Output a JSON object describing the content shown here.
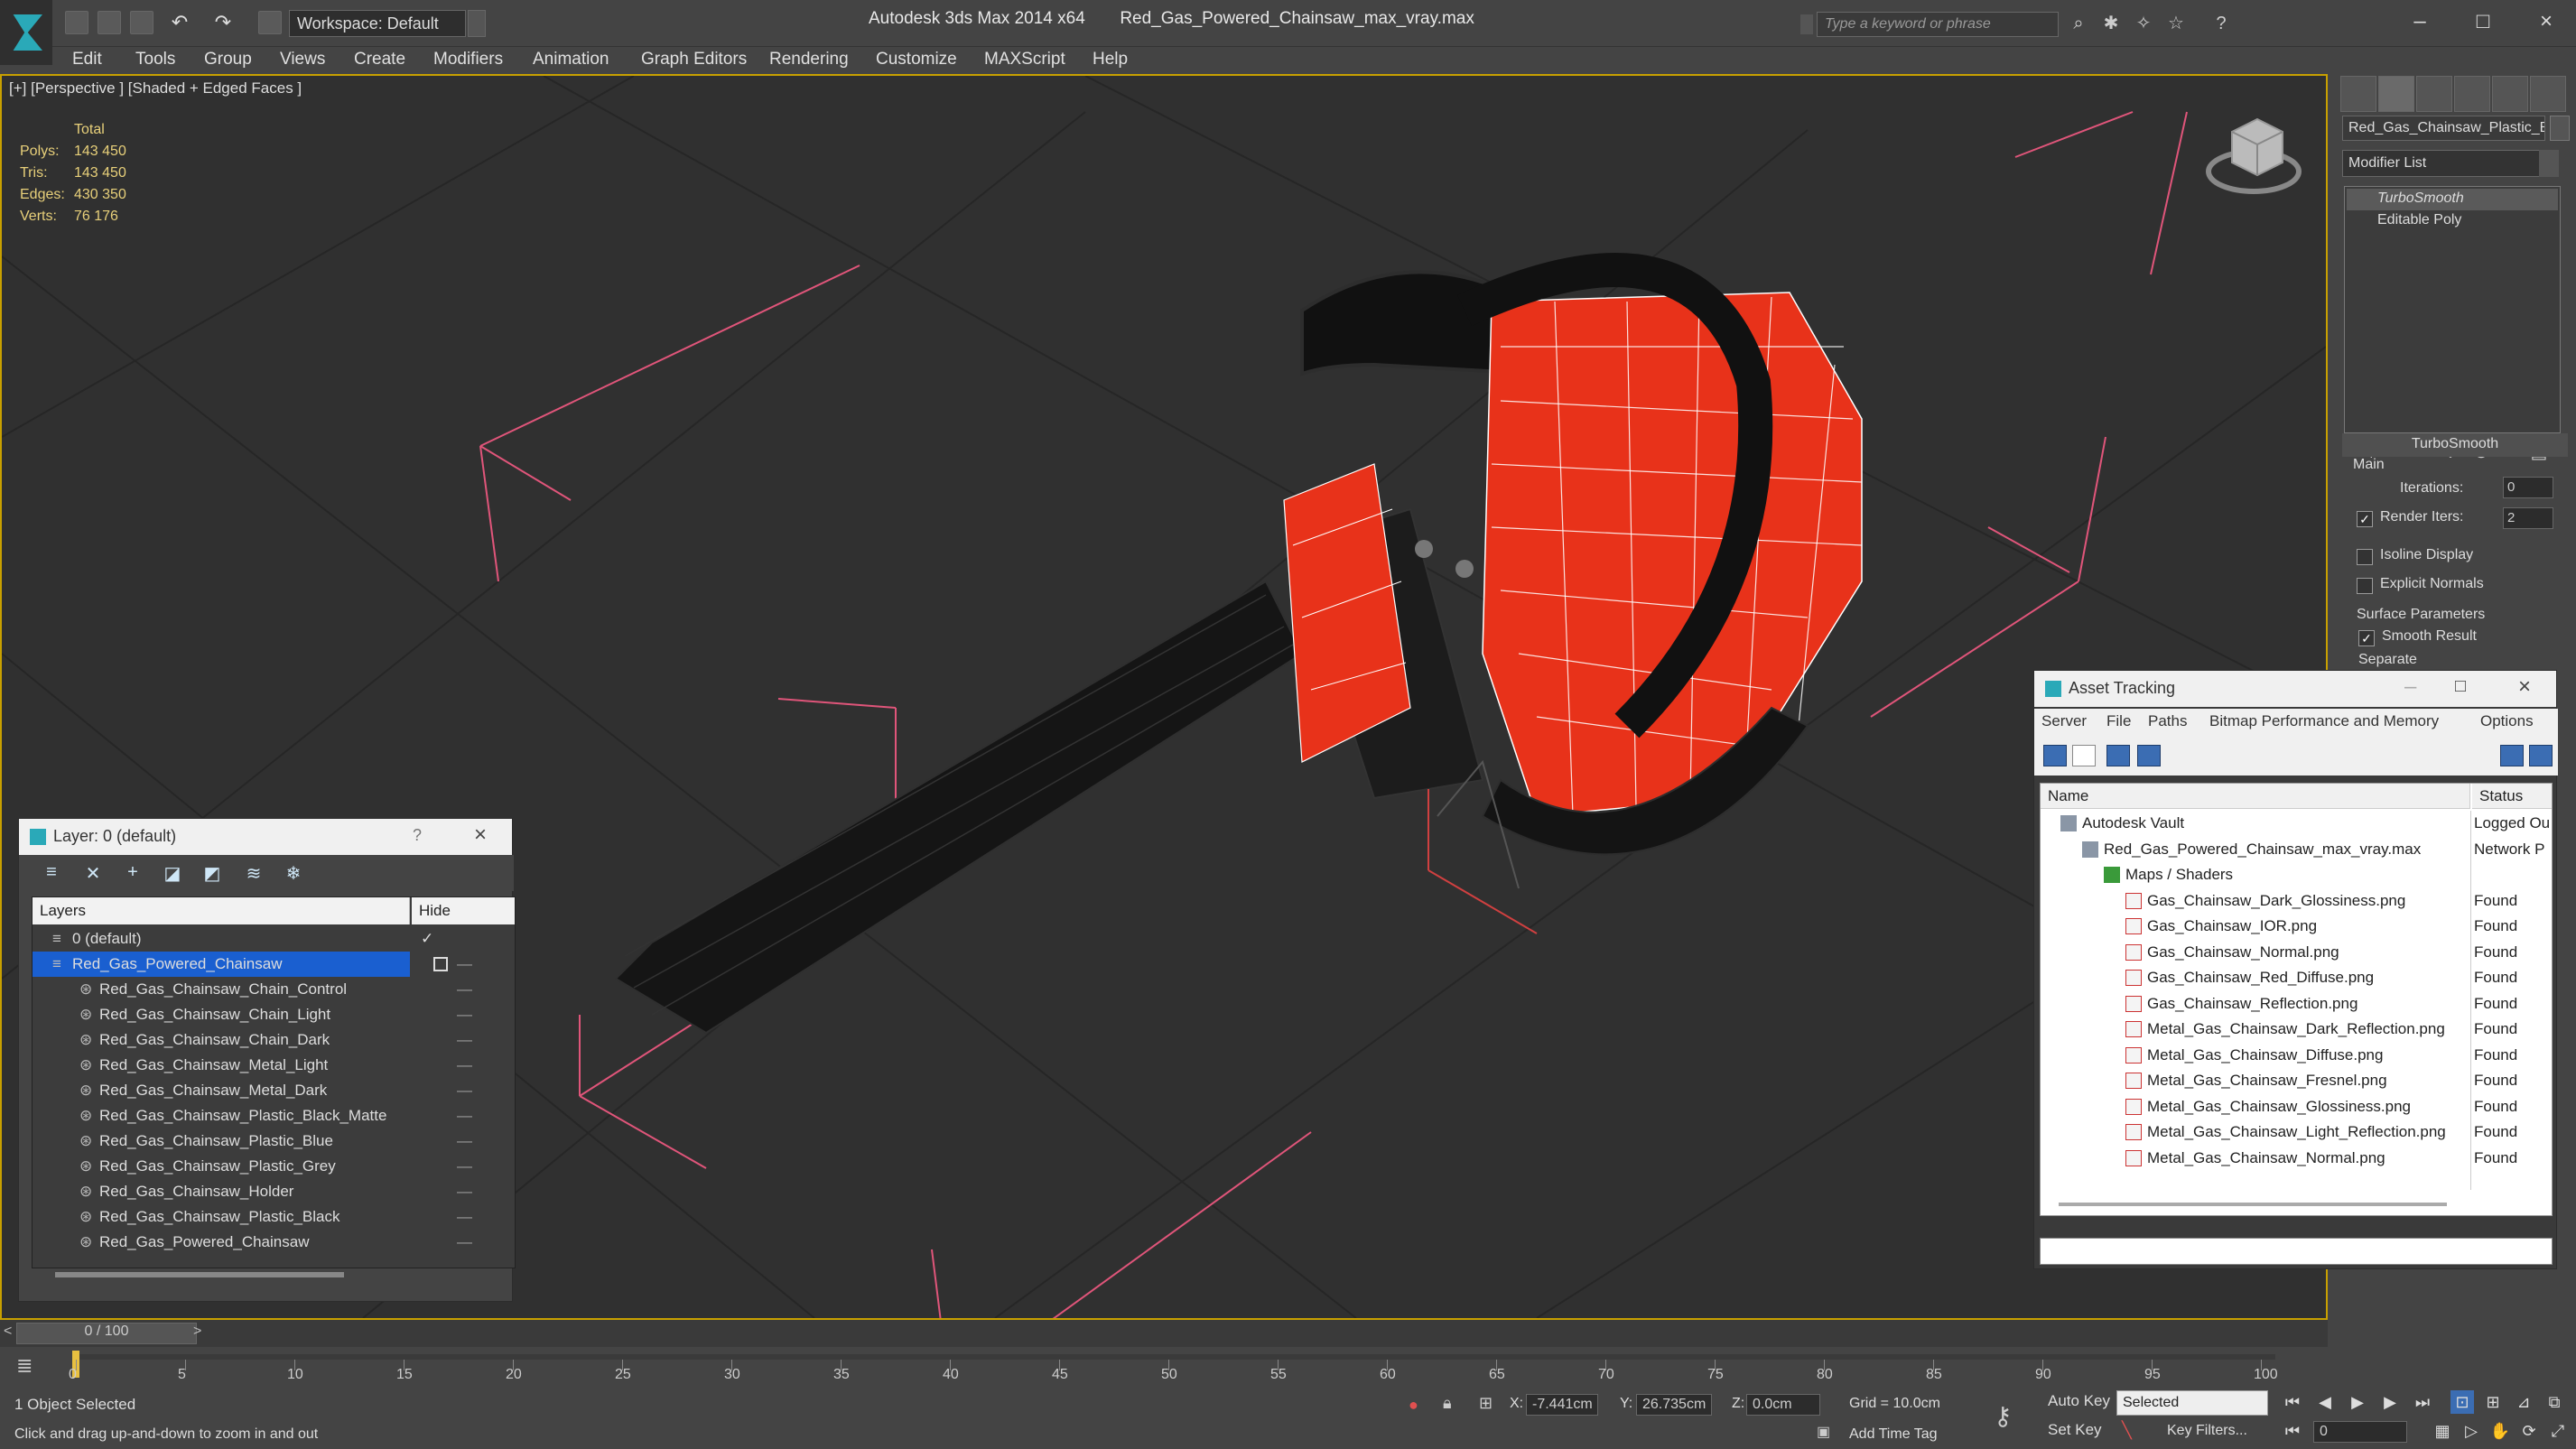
{
  "app": {
    "title": "Autodesk 3ds Max  2014 x64",
    "file": "Red_Gas_Powered_Chainsaw_max_vray.max",
    "workspace": "Workspace: Default",
    "search_placeholder": "Type a keyword or phrase"
  },
  "menus": [
    "Edit",
    "Tools",
    "Group",
    "Views",
    "Create",
    "Modifiers",
    "Animation",
    "Graph Editors",
    "Rendering",
    "Customize",
    "MAXScript",
    "Help"
  ],
  "viewport": {
    "label": "[+] [Perspective ] [Shaded + Edged Faces ]",
    "stats": {
      "header": "Total",
      "rows": [
        {
          "label": "Polys:",
          "value": "143 450"
        },
        {
          "label": "Tris:",
          "value": "143 450"
        },
        {
          "label": "Edges:",
          "value": "430 350"
        },
        {
          "label": "Verts:",
          "value": "76 176"
        }
      ]
    }
  },
  "command_panel": {
    "object_name": "Red_Gas_Chainsaw_Plastic_B",
    "modifier_list": "Modifier List",
    "stack": [
      "TurboSmooth",
      "Editable Poly"
    ],
    "rollout_title": "TurboSmooth",
    "main_group": "Main",
    "iterations_label": "Iterations:",
    "iterations_value": "0",
    "render_iters_label": "Render Iters:",
    "render_iters_value": "2",
    "isoline": "Isoline Display",
    "explicit_normals": "Explicit Normals",
    "surface_group": "Surface Parameters",
    "smooth_result": "Smooth Result",
    "separate": "Separate"
  },
  "layer_panel": {
    "title": "Layer: 0 (default)",
    "help": "?",
    "col_layers": "Layers",
    "col_hide": "Hide",
    "rows": [
      {
        "name": "0 (default)",
        "level": 0
      },
      {
        "name": "Red_Gas_Powered_Chainsaw",
        "level": 0
      },
      {
        "name": "Red_Gas_Chainsaw_Chain_Control",
        "level": 1
      },
      {
        "name": "Red_Gas_Chainsaw_Chain_Light",
        "level": 1
      },
      {
        "name": "Red_Gas_Chainsaw_Chain_Dark",
        "level": 1
      },
      {
        "name": "Red_Gas_Chainsaw_Metal_Light",
        "level": 1
      },
      {
        "name": "Red_Gas_Chainsaw_Metal_Dark",
        "level": 1
      },
      {
        "name": "Red_Gas_Chainsaw_Plastic_Black_Matte",
        "level": 1
      },
      {
        "name": "Red_Gas_Chainsaw_Plastic_Blue",
        "level": 1
      },
      {
        "name": "Red_Gas_Chainsaw_Plastic_Grey",
        "level": 1
      },
      {
        "name": "Red_Gas_Chainsaw_Holder",
        "level": 1
      },
      {
        "name": "Red_Gas_Chainsaw_Plastic_Black",
        "level": 1
      },
      {
        "name": "Red_Gas_Powered_Chainsaw",
        "level": 1
      }
    ]
  },
  "asset_panel": {
    "title": "Asset Tracking",
    "menus": [
      "Server",
      "File",
      "Paths",
      "Bitmap Performance and Memory",
      "Options"
    ],
    "col_name": "Name",
    "col_status": "Status",
    "rows": [
      {
        "name": "Autodesk Vault",
        "status": "Logged Ou",
        "level": 0
      },
      {
        "name": "Red_Gas_Powered_Chainsaw_max_vray.max",
        "status": "Network P",
        "level": 1
      },
      {
        "name": "Maps / Shaders",
        "status": "",
        "level": 2
      },
      {
        "name": "Gas_Chainsaw_Dark_Glossiness.png",
        "status": "Found",
        "level": 3
      },
      {
        "name": "Gas_Chainsaw_IOR.png",
        "status": "Found",
        "level": 3
      },
      {
        "name": "Gas_Chainsaw_Normal.png",
        "status": "Found",
        "level": 3
      },
      {
        "name": "Gas_Chainsaw_Red_Diffuse.png",
        "status": "Found",
        "level": 3
      },
      {
        "name": "Gas_Chainsaw_Reflection.png",
        "status": "Found",
        "level": 3
      },
      {
        "name": "Metal_Gas_Chainsaw_Dark_Reflection.png",
        "status": "Found",
        "level": 3
      },
      {
        "name": "Metal_Gas_Chainsaw_Diffuse.png",
        "status": "Found",
        "level": 3
      },
      {
        "name": "Metal_Gas_Chainsaw_Fresnel.png",
        "status": "Found",
        "level": 3
      },
      {
        "name": "Metal_Gas_Chainsaw_Glossiness.png",
        "status": "Found",
        "level": 3
      },
      {
        "name": "Metal_Gas_Chainsaw_Light_Reflection.png",
        "status": "Found",
        "level": 3
      },
      {
        "name": "Metal_Gas_Chainsaw_Normal.png",
        "status": "Found",
        "level": 3
      }
    ]
  },
  "timeline": {
    "slider": "0 / 100",
    "ticks": [
      "0",
      "5",
      "10",
      "15",
      "20",
      "25",
      "30",
      "35",
      "40",
      "45",
      "50",
      "55",
      "60",
      "65",
      "70",
      "75",
      "80",
      "85",
      "90",
      "95",
      "100"
    ]
  },
  "status": {
    "selection": "1 Object Selected",
    "prompt": "Click and drag up-and-down to zoom in and out",
    "x_label": "X:",
    "x": "-7.441cm",
    "y_label": "Y:",
    "y": "26.735cm",
    "z_label": "Z:",
    "z": "0.0cm",
    "grid": "Grid = 10.0cm",
    "add_time_tag": "Add Time Tag",
    "auto_key": "Auto Key",
    "set_key": "Set Key",
    "selected": "Selected",
    "key_filters": "Key Filters...",
    "frame": "0"
  },
  "colors": {
    "chainsaw_red": "#e8321a",
    "viewport_bg": "#303030",
    "active_border": "#c8a000",
    "selection_blue": "#1a5fd0",
    "bbox_pink": "#e0557a"
  }
}
